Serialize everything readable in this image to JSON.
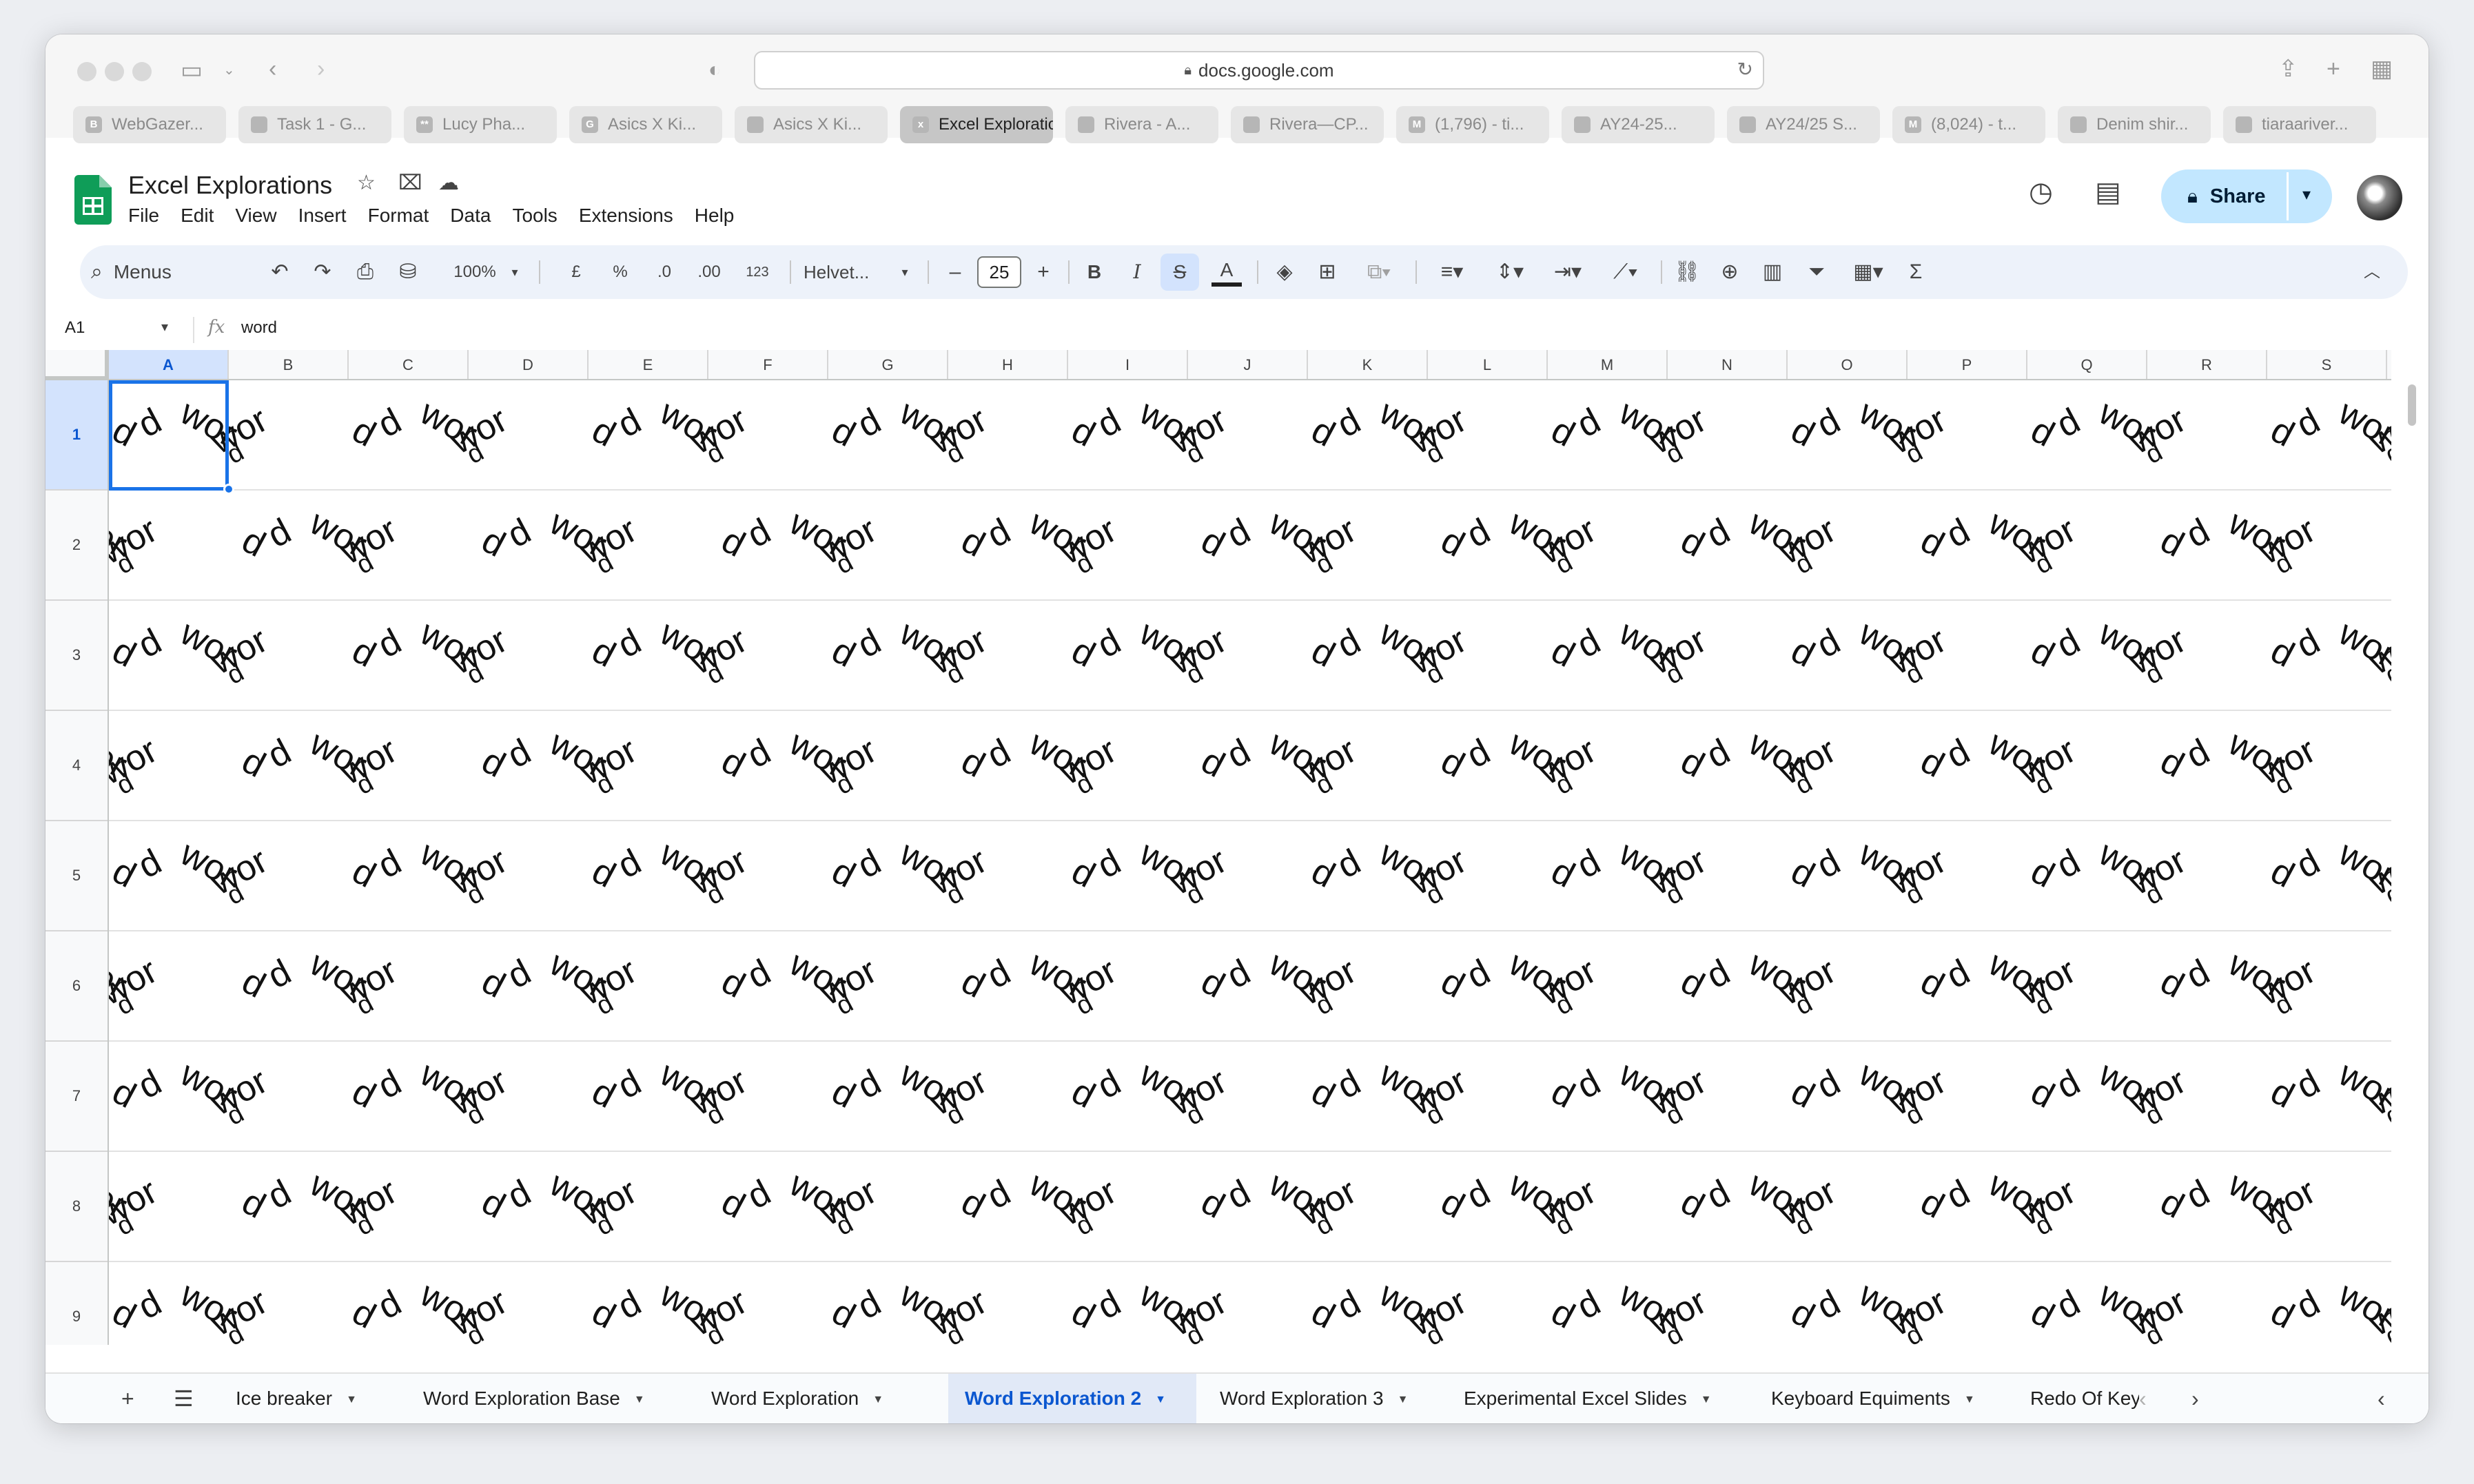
{
  "browser": {
    "url": "docs.google.com",
    "tabs": [
      {
        "label": "WebGazer...",
        "icon": "B",
        "active": false
      },
      {
        "label": "Task 1 - G...",
        "icon": "",
        "active": false
      },
      {
        "label": "Lucy Pha...",
        "icon": "**",
        "active": false
      },
      {
        "label": "Asics X Ki...",
        "icon": "G",
        "active": false
      },
      {
        "label": "Asics X Ki...",
        "icon": "",
        "active": false
      },
      {
        "label": "Excel Exploration...",
        "icon": "x",
        "active": true
      },
      {
        "label": "Rivera - A...",
        "icon": "",
        "active": false
      },
      {
        "label": "Rivera—CP...",
        "icon": "",
        "active": false
      },
      {
        "label": "(1,796) - ti...",
        "icon": "M",
        "active": false
      },
      {
        "label": "AY24-25...",
        "icon": "",
        "active": false
      },
      {
        "label": "AY24/25 S...",
        "icon": "",
        "active": false
      },
      {
        "label": "(8,024) - t...",
        "icon": "M",
        "active": false
      },
      {
        "label": "Denim shir...",
        "icon": "",
        "active": false
      },
      {
        "label": "tiaraariver...",
        "icon": "",
        "active": false
      }
    ]
  },
  "doc": {
    "title": "Excel Explorations",
    "menu": [
      "File",
      "Edit",
      "View",
      "Insert",
      "Format",
      "Data",
      "Tools",
      "Extensions",
      "Help"
    ],
    "share_label": "Share"
  },
  "toolbar": {
    "menus_label": "Menus",
    "zoom": "100%",
    "currency": "£",
    "percent": "%",
    "dec_decrease": ".0",
    "dec_increase": ".00",
    "number_format": "123",
    "font": "Helvet...",
    "font_size": "25",
    "bold": "B",
    "italic": "I",
    "text_color": "A",
    "sum": "Σ"
  },
  "formula_bar": {
    "cell_ref": "A1",
    "fx": "fx",
    "value": "word"
  },
  "grid": {
    "columns": [
      "A",
      "B",
      "C",
      "D",
      "E",
      "F",
      "G",
      "H",
      "I",
      "J",
      "K",
      "L",
      "M",
      "N",
      "O",
      "P",
      "Q",
      "R",
      "S"
    ],
    "rows": [
      "1",
      "2",
      "3",
      "4",
      "5",
      "6",
      "7",
      "8",
      "9"
    ],
    "selected_cell": "A1",
    "cell_text": "word"
  },
  "sheets": {
    "tabs": [
      {
        "label": "Ice breaker",
        "active": false
      },
      {
        "label": "Word Exploration Base",
        "active": false
      },
      {
        "label": "Word Exploration",
        "active": false
      },
      {
        "label": "Word Exploration 2",
        "active": true
      },
      {
        "label": "Word Exploration 3",
        "active": false
      },
      {
        "label": "Experimental Excel Slides",
        "active": false
      },
      {
        "label": "Keyboard Equiments",
        "active": false
      },
      {
        "label": "Redo Of Keybo",
        "active": false
      }
    ]
  },
  "colors": {
    "accent": "#1a73e8",
    "share_bg": "#c2e7ff",
    "toolbar_bg": "#edf2fa",
    "sheets_green": "#0f9d58"
  }
}
